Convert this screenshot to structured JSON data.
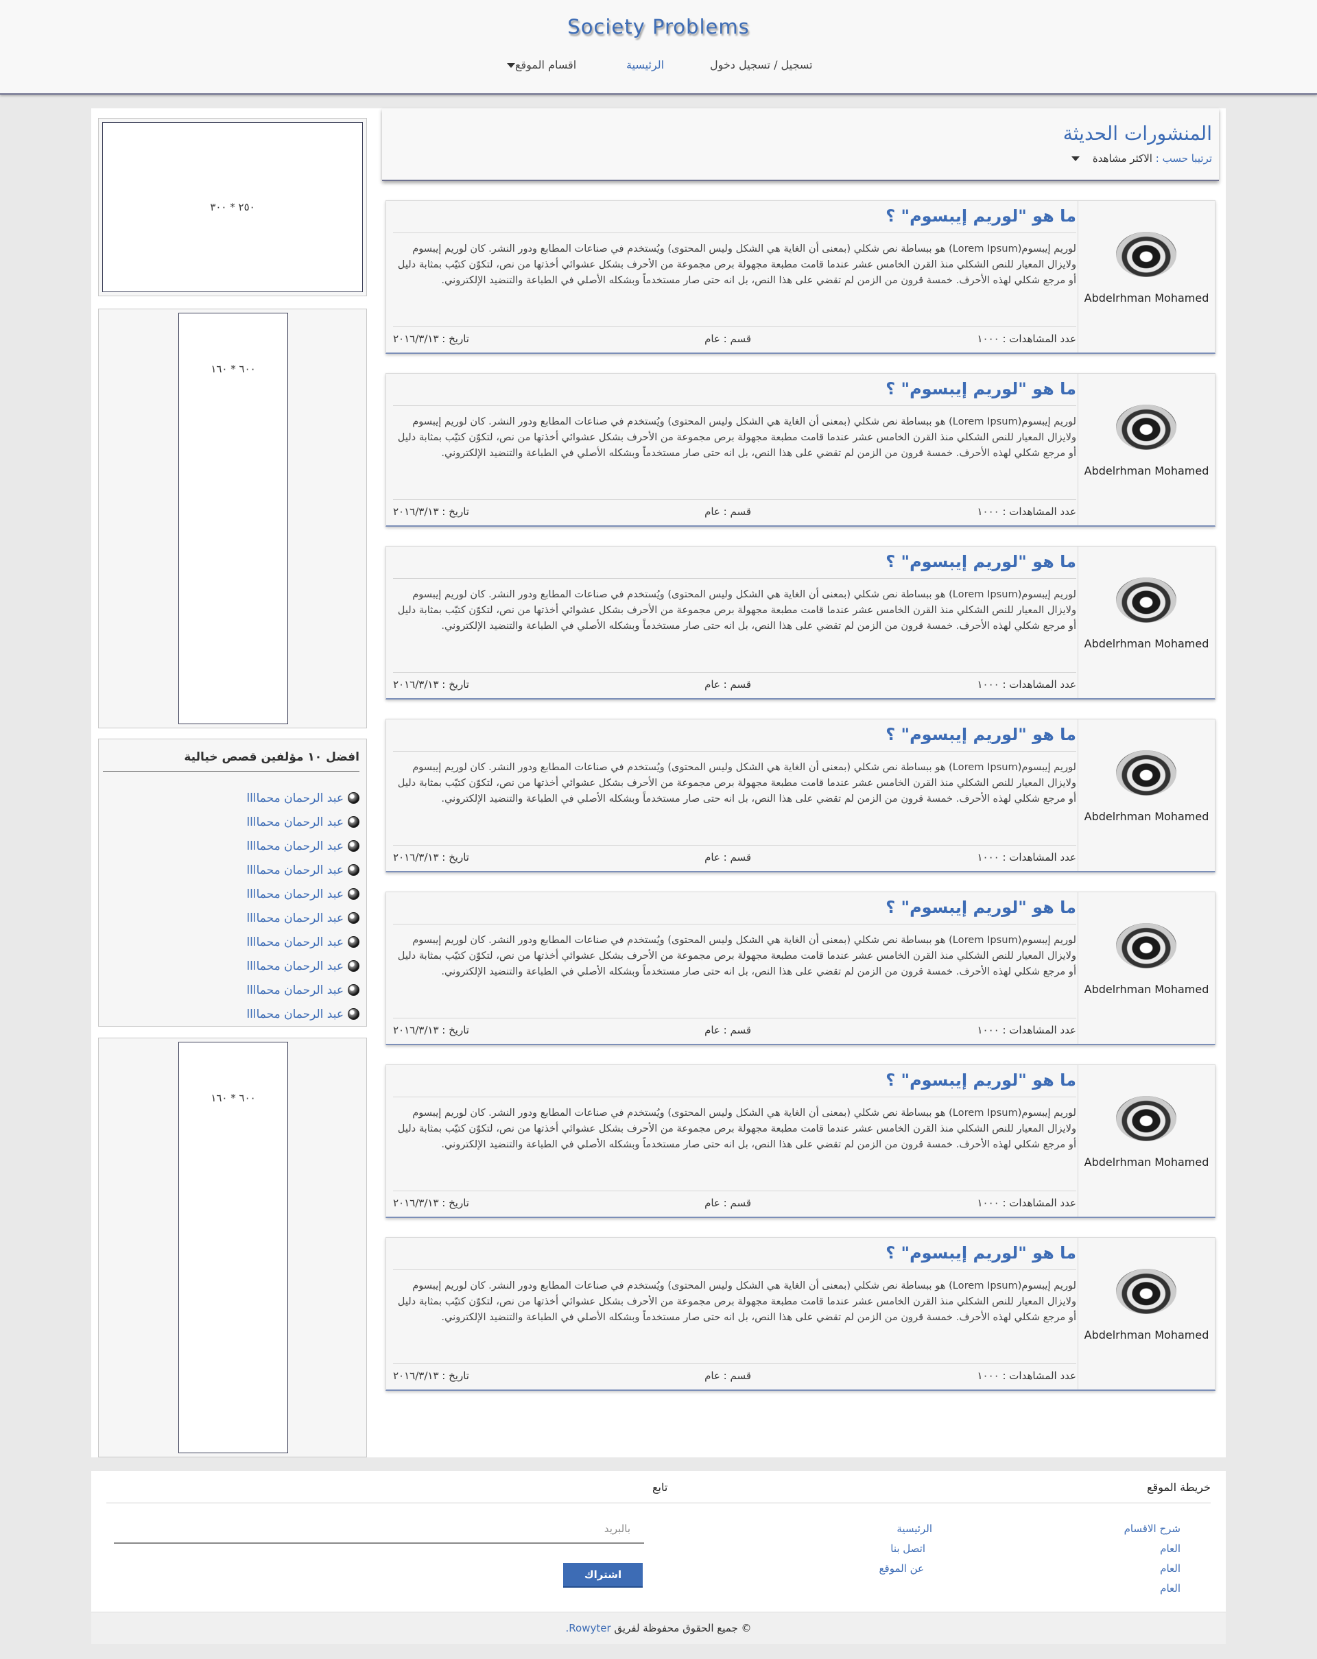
{
  "header": {
    "logo": "Society Problems",
    "nav": {
      "register": "تسجيل / تسجيل دخول",
      "home": "الرئيسية",
      "sections": "اقسام الموقع"
    }
  },
  "posts_header": {
    "title": "المنشورات الحديثة",
    "sort_label": "ترتيبا حسب :",
    "sort_value": "الاكثر مشاهدة"
  },
  "posts": [
    {
      "author": "Abdelrhman Mohamed",
      "title": "ما هو \"لوريم إيبسوم\" ؟",
      "body": "لوريم إيبسوم(Lorem Ipsum) هو ببساطة نص شكلي (بمعنى أن الغاية هي الشكل وليس المحتوى) ويُستخدم في صناعات المطابع ودور النشر. كان لوريم إيبسوم ولايزال المعيار للنص الشكلي منذ القرن الخامس عشر عندما قامت مطبعة مجهولة برص مجموعة من الأحرف بشكل عشوائي أخذتها من نص، لتكوّن كتيّب بمثابة دليل أو مرجع شكلي لهذه الأحرف. خمسة قرون من الزمن لم تقضي على هذا النص، بل انه حتى صار مستخدماً وبشكله الأصلي في الطباعة والتنضيد الإلكتروني.",
      "views": "عدد المشاهدات : ١٠٠٠",
      "category": "قسم : عام",
      "date": "تاريخ : ٢٠١٦/٣/١٣"
    },
    {
      "author": "Abdelrhman Mohamed",
      "title": "ما هو \"لوريم إيبسوم\" ؟",
      "body": "لوريم إيبسوم(Lorem Ipsum) هو ببساطة نص شكلي (بمعنى أن الغاية هي الشكل وليس المحتوى) ويُستخدم في صناعات المطابع ودور النشر. كان لوريم إيبسوم ولايزال المعيار للنص الشكلي منذ القرن الخامس عشر عندما قامت مطبعة مجهولة برص مجموعة من الأحرف بشكل عشوائي أخذتها من نص، لتكوّن كتيّب بمثابة دليل أو مرجع شكلي لهذه الأحرف. خمسة قرون من الزمن لم تقضي على هذا النص، بل انه حتى صار مستخدماً وبشكله الأصلي في الطباعة والتنضيد الإلكتروني.",
      "views": "عدد المشاهدات : ١٠٠٠",
      "category": "قسم : عام",
      "date": "تاريخ : ٢٠١٦/٣/١٣"
    },
    {
      "author": "Abdelrhman Mohamed",
      "title": "ما هو \"لوريم إيبسوم\" ؟",
      "body": "لوريم إيبسوم(Lorem Ipsum) هو ببساطة نص شكلي (بمعنى أن الغاية هي الشكل وليس المحتوى) ويُستخدم في صناعات المطابع ودور النشر. كان لوريم إيبسوم ولايزال المعيار للنص الشكلي منذ القرن الخامس عشر عندما قامت مطبعة مجهولة برص مجموعة من الأحرف بشكل عشوائي أخذتها من نص، لتكوّن كتيّب بمثابة دليل أو مرجع شكلي لهذه الأحرف. خمسة قرون من الزمن لم تقضي على هذا النص، بل انه حتى صار مستخدماً وبشكله الأصلي في الطباعة والتنضيد الإلكتروني.",
      "views": "عدد المشاهدات : ١٠٠٠",
      "category": "قسم : عام",
      "date": "تاريخ : ٢٠١٦/٣/١٣"
    },
    {
      "author": "Abdelrhman Mohamed",
      "title": "ما هو \"لوريم إيبسوم\" ؟",
      "body": "لوريم إيبسوم(Lorem Ipsum) هو ببساطة نص شكلي (بمعنى أن الغاية هي الشكل وليس المحتوى) ويُستخدم في صناعات المطابع ودور النشر. كان لوريم إيبسوم ولايزال المعيار للنص الشكلي منذ القرن الخامس عشر عندما قامت مطبعة مجهولة برص مجموعة من الأحرف بشكل عشوائي أخذتها من نص، لتكوّن كتيّب بمثابة دليل أو مرجع شكلي لهذه الأحرف. خمسة قرون من الزمن لم تقضي على هذا النص، بل انه حتى صار مستخدماً وبشكله الأصلي في الطباعة والتنضيد الإلكتروني.",
      "views": "عدد المشاهدات : ١٠٠٠",
      "category": "قسم : عام",
      "date": "تاريخ : ٢٠١٦/٣/١٣"
    },
    {
      "author": "Abdelrhman Mohamed",
      "title": "ما هو \"لوريم إيبسوم\" ؟",
      "body": "لوريم إيبسوم(Lorem Ipsum) هو ببساطة نص شكلي (بمعنى أن الغاية هي الشكل وليس المحتوى) ويُستخدم في صناعات المطابع ودور النشر. كان لوريم إيبسوم ولايزال المعيار للنص الشكلي منذ القرن الخامس عشر عندما قامت مطبعة مجهولة برص مجموعة من الأحرف بشكل عشوائي أخذتها من نص، لتكوّن كتيّب بمثابة دليل أو مرجع شكلي لهذه الأحرف. خمسة قرون من الزمن لم تقضي على هذا النص، بل انه حتى صار مستخدماً وبشكله الأصلي في الطباعة والتنضيد الإلكتروني.",
      "views": "عدد المشاهدات : ١٠٠٠",
      "category": "قسم : عام",
      "date": "تاريخ : ٢٠١٦/٣/١٣"
    },
    {
      "author": "Abdelrhman Mohamed",
      "title": "ما هو \"لوريم إيبسوم\" ؟",
      "body": "لوريم إيبسوم(Lorem Ipsum) هو ببساطة نص شكلي (بمعنى أن الغاية هي الشكل وليس المحتوى) ويُستخدم في صناعات المطابع ودور النشر. كان لوريم إيبسوم ولايزال المعيار للنص الشكلي منذ القرن الخامس عشر عندما قامت مطبعة مجهولة برص مجموعة من الأحرف بشكل عشوائي أخذتها من نص، لتكوّن كتيّب بمثابة دليل أو مرجع شكلي لهذه الأحرف. خمسة قرون من الزمن لم تقضي على هذا النص، بل انه حتى صار مستخدماً وبشكله الأصلي في الطباعة والتنضيد الإلكتروني.",
      "views": "عدد المشاهدات : ١٠٠٠",
      "category": "قسم : عام",
      "date": "تاريخ : ٢٠١٦/٣/١٣"
    },
    {
      "author": "Abdelrhman Mohamed",
      "title": "ما هو \"لوريم إيبسوم\" ؟",
      "body": "لوريم إيبسوم(Lorem Ipsum) هو ببساطة نص شكلي (بمعنى أن الغاية هي الشكل وليس المحتوى) ويُستخدم في صناعات المطابع ودور النشر. كان لوريم إيبسوم ولايزال المعيار للنص الشكلي منذ القرن الخامس عشر عندما قامت مطبعة مجهولة برص مجموعة من الأحرف بشكل عشوائي أخذتها من نص، لتكوّن كتيّب بمثابة دليل أو مرجع شكلي لهذه الأحرف. خمسة قرون من الزمن لم تقضي على هذا النص، بل انه حتى صار مستخدماً وبشكله الأصلي في الطباعة والتنضيد الإلكتروني.",
      "views": "عدد المشاهدات : ١٠٠٠",
      "category": "قسم : عام",
      "date": "تاريخ : ٢٠١٦/٣/١٣"
    }
  ],
  "sidebar": {
    "ad_top": "٢٥٠ * ٣٠٠",
    "ad_middle": "٦٠٠ * ١٦٠",
    "ad_bottom": "٦٠٠ * ١٦٠",
    "authors_title": "افضل ١٠ مؤلفين قصص خيالية",
    "authors": [
      "عبد الرحمان محماااا",
      "عبد الرحمان محماااا",
      "عبد الرحمان محماااا",
      "عبد الرحمان محماااا",
      "عبد الرحمان محماااا",
      "عبد الرحمان محماااا",
      "عبد الرحمان محماااا",
      "عبد الرحمان محماااا",
      "عبد الرحمان محماااا",
      "عبد الرحمان محماااا"
    ]
  },
  "footer": {
    "sitemap_title": "خريطة الموقع",
    "sitemap_col1": [
      "شرح الاقسام",
      "العام",
      "العام",
      "العام"
    ],
    "sitemap_col2": [
      "الرئيسية",
      "اتصل بنا",
      "عن الموقع"
    ],
    "follow_title": "تابع",
    "email_placeholder": "بالبريد",
    "subscribe_label": "اشتراك",
    "copyright_text": "© جميع الحقوق محفوظة لفريق",
    "copyright_brand": "Rowyter."
  },
  "colors": {
    "accent": "#3d6cb5",
    "header_border": "#6f7290",
    "page_bg": "#e9e9e9"
  }
}
